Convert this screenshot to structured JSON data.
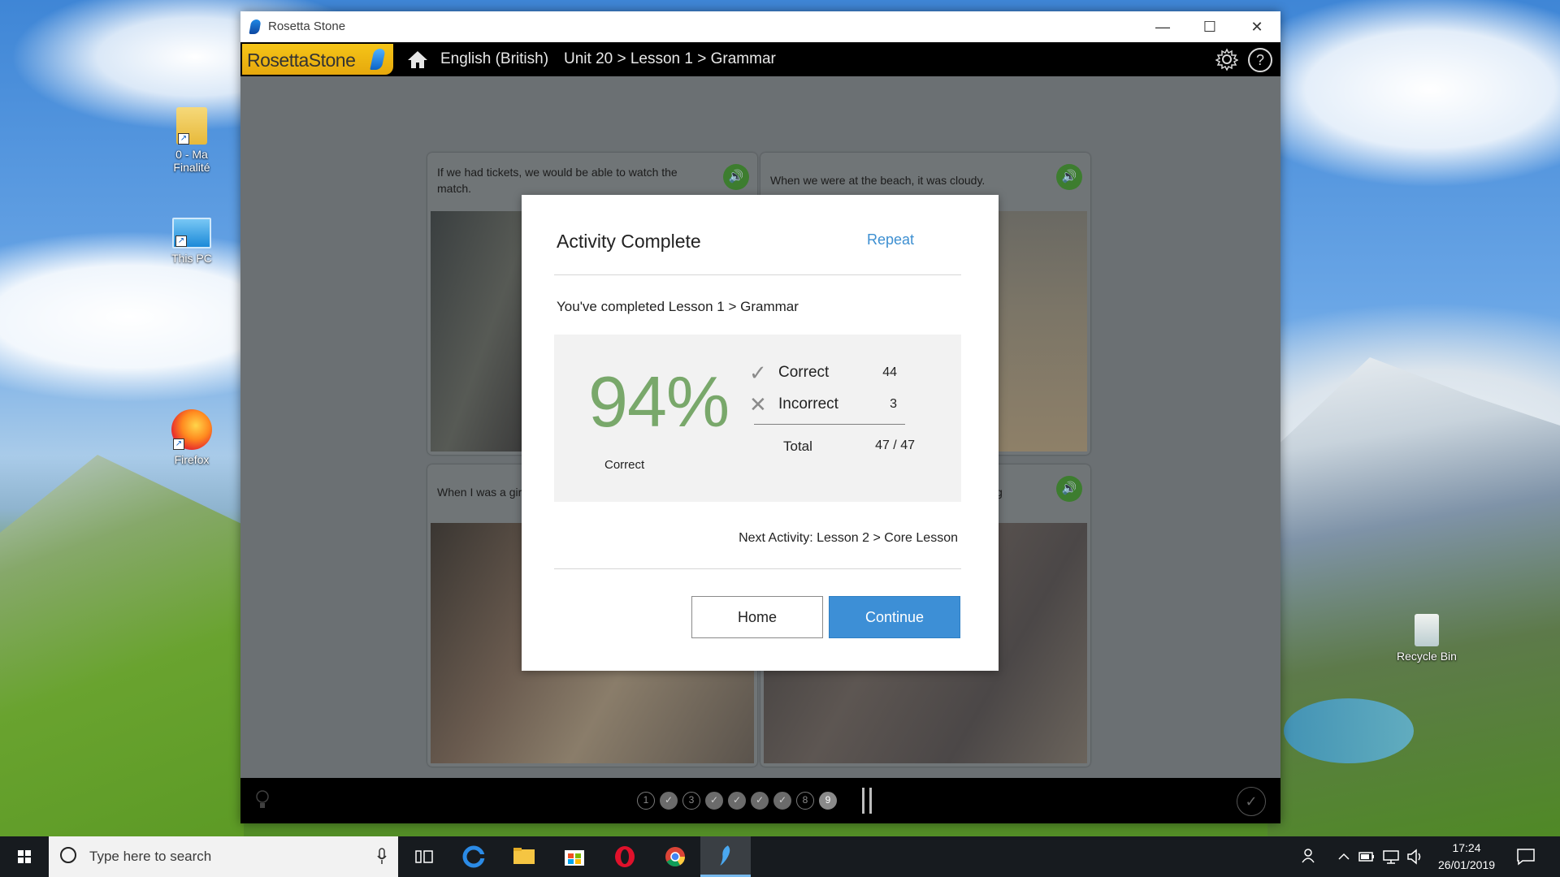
{
  "desktop": {
    "icons": [
      {
        "label": "0 - Ma Finalité"
      },
      {
        "label": "This PC"
      },
      {
        "label": "Firefox"
      },
      {
        "label": "Recycle Bin"
      }
    ]
  },
  "window": {
    "title": "Rosetta Stone",
    "controls": {
      "minimize": "—",
      "maximize": "☐",
      "close": "✕"
    }
  },
  "nav": {
    "logo_text_1": "Rosetta",
    "logo_text_2": "Stone",
    "language": "English (British)",
    "path": "Unit 20 > Lesson 1 > Grammar",
    "help": "?"
  },
  "cards": [
    {
      "caption": "If we had tickets, we would be able to watch the match."
    },
    {
      "caption": "When we were at the beach, it was cloudy."
    },
    {
      "caption": "When I was a gir"
    },
    {
      "caption": "g"
    }
  ],
  "progress": {
    "steps": [
      {
        "label": "1",
        "state": "todo"
      },
      {
        "label": "✓",
        "state": "done"
      },
      {
        "label": "3",
        "state": "todo"
      },
      {
        "label": "✓",
        "state": "done"
      },
      {
        "label": "✓",
        "state": "done"
      },
      {
        "label": "✓",
        "state": "done"
      },
      {
        "label": "✓",
        "state": "done"
      },
      {
        "label": "8",
        "state": "todo"
      },
      {
        "label": "9",
        "state": "active"
      }
    ],
    "check": "✓"
  },
  "modal": {
    "title": "Activity Complete",
    "repeat": "Repeat",
    "subtitle": "You've completed Lesson 1 > Grammar",
    "percent": "94%",
    "percent_label": "Correct",
    "correct_label": "Correct",
    "correct_value": "44",
    "incorrect_label": "Incorrect",
    "incorrect_value": "3",
    "total_label": "Total",
    "total_value": "47 / 47",
    "next_activity": "Next Activity: Lesson 2 > Core Lesson",
    "home_button": "Home",
    "continue_button": "Continue",
    "accent_color": "#3d8fd6",
    "score_color": "#79a86b"
  },
  "taskbar": {
    "search_placeholder": "Type here to search",
    "time": "17:24",
    "date": "26/01/2019"
  }
}
